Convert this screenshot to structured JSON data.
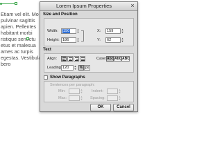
{
  "document": {
    "lines": [
      "Etiam vel elit. Mo",
      "pulvinar sagittis",
      "apien. Pellentes",
      "habitant morbi",
      "ristique senectu",
      "etus et malesua",
      "ames ac turpis",
      "egestas. Vestibula",
      "bero"
    ]
  },
  "dialog": {
    "title": "Lorem Ipsum Properties",
    "close": "×",
    "size_position": {
      "header": "Size and Position",
      "width_label": "Width:",
      "width_value": "150",
      "height_label": "Height:",
      "height_value": "186",
      "x_label": "X:",
      "x_value": "159",
      "y_label": "Y:",
      "y_value": "62"
    },
    "text": {
      "header": "Text",
      "align_label": "Align:",
      "case_label": "Case:",
      "case_options": [
        "Abc",
        "AbC",
        "ABC"
      ],
      "leading_label": "Leading:",
      "leading_value": "120",
      "unit_percent": "%",
      "unit_px": "px"
    },
    "paragraphs": {
      "checkbox_label": "Show Paragraphs",
      "sentences_label": "Sentences per paragraph:",
      "min_label": "Min:",
      "min_value": "",
      "max_label": "Max:",
      "max_value": "",
      "indent_label": "Indent:",
      "indent_value": "",
      "spacing_label": "Spacing:",
      "spacing_value": ""
    },
    "buttons": {
      "ok": "OK",
      "cancel": "Cancel"
    }
  },
  "icons": {
    "spin_up": "▲",
    "spin_down": "▼"
  },
  "colors": {
    "selection": "#2f6fd6",
    "handle": "#3aa64a"
  }
}
